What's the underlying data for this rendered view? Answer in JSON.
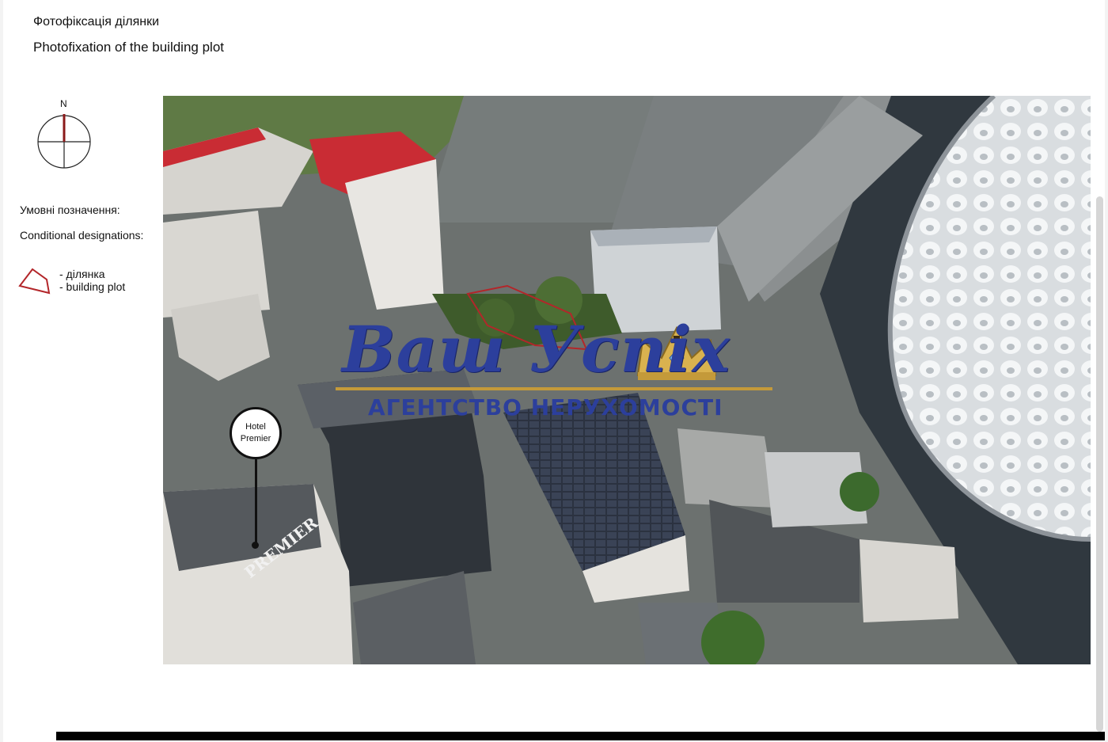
{
  "header": {
    "title_ua": "Фотофіксація ділянки",
    "title_en": "Photofixation of the building plot"
  },
  "compass": {
    "label": "N"
  },
  "legend": {
    "title_ua": "Умовні позначення:",
    "title_en": "Conditional designations:",
    "plot_ua": "- ділянка",
    "plot_en": "- building plot"
  },
  "photo": {
    "hotel_label_line1": "Hotel",
    "hotel_label_line2": "Premier",
    "rooftop_sign": "PREMIER"
  },
  "watermark": {
    "main": "Ваш Успіх",
    "sub": "АГЕНТСТВО НЕРУХОМОСТІ"
  },
  "colors": {
    "plot_outline": "#b3262a",
    "compass_accent": "#8b1a1a",
    "watermark_blue": "#2c3f9c",
    "watermark_gold": "#c49a3a"
  }
}
